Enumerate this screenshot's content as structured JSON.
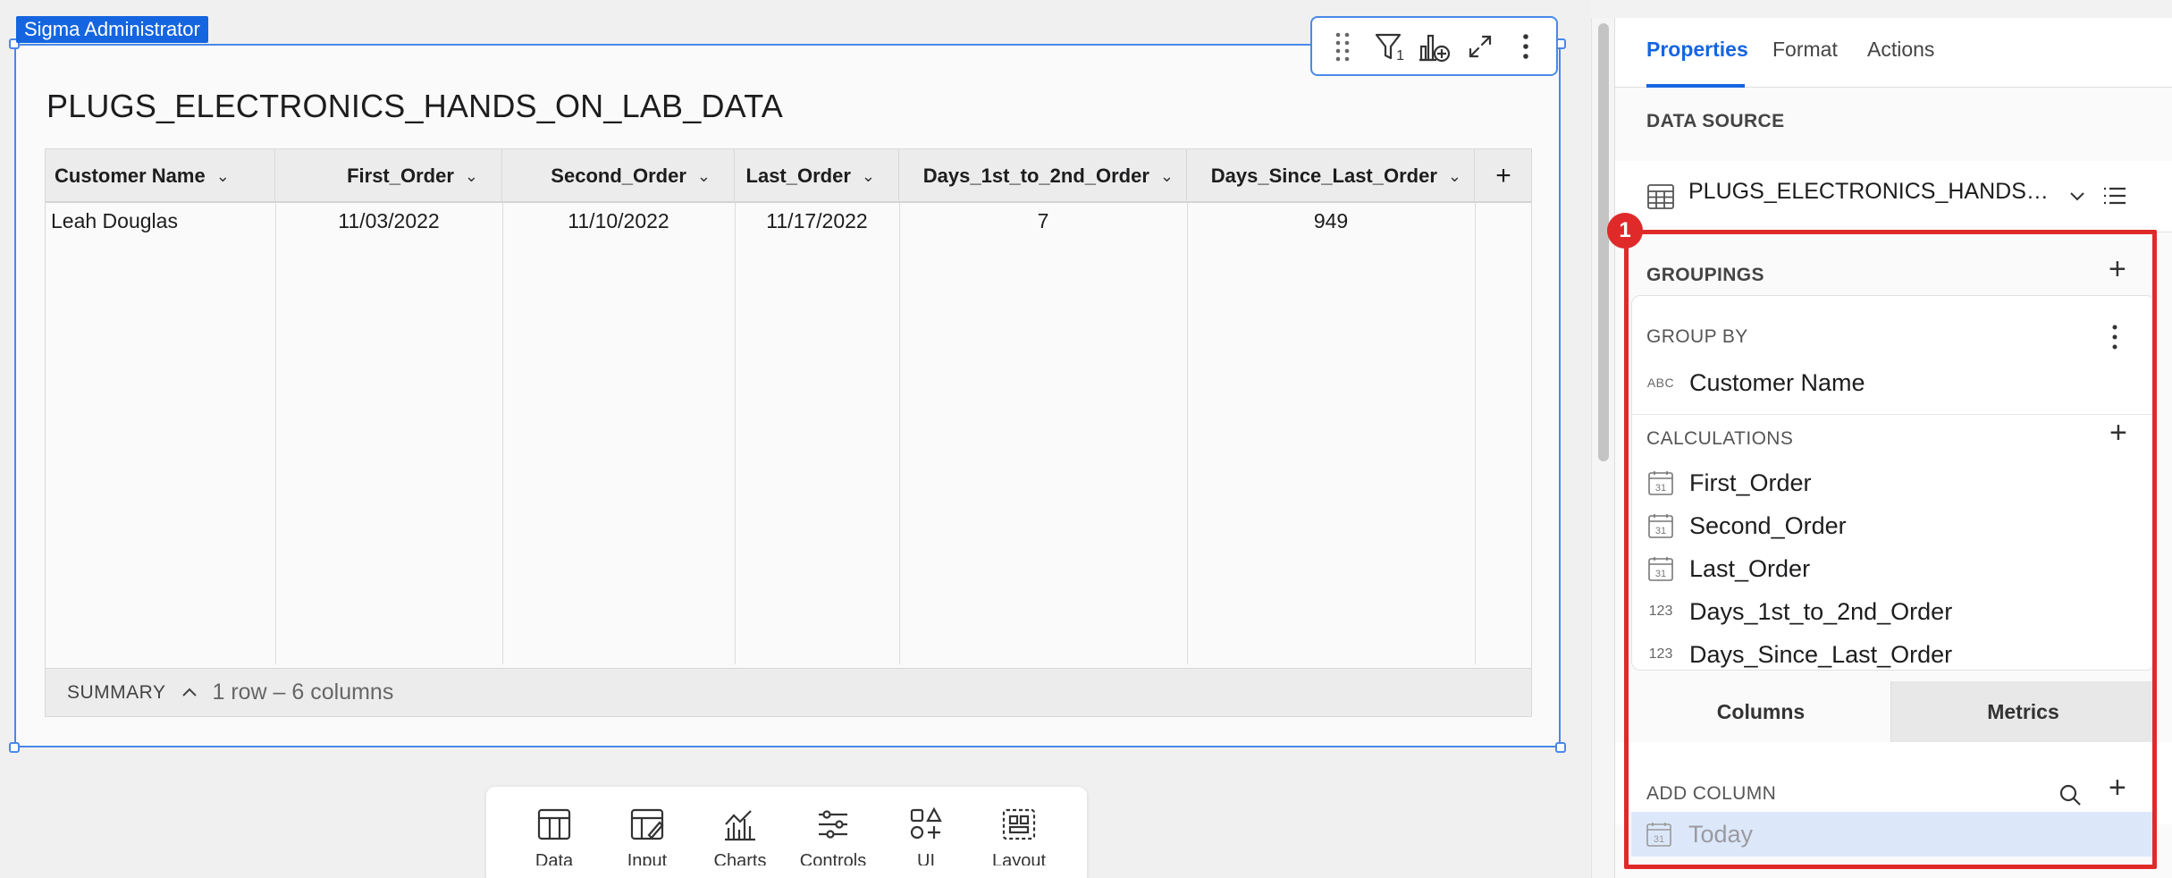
{
  "element_tag": "Sigma Administrator",
  "table": {
    "title": "PLUGS_ELECTRONICS_HANDS_ON_LAB_DATA",
    "columns": [
      "Customer Name",
      "First_Order",
      "Second_Order",
      "Last_Order",
      "Days_1st_to_2nd_Order",
      "Days_Since_Last_Order"
    ],
    "add_column_symbol": "+",
    "rows": [
      [
        "Leah Douglas",
        "11/03/2022",
        "11/10/2022",
        "11/17/2022",
        "7",
        "949"
      ]
    ],
    "summary": {
      "label": "SUMMARY",
      "chevron": "^",
      "count": "1 row – 6 columns"
    }
  },
  "toolbar": {
    "filter_count": "1",
    "icons": [
      "drag-handle-icon",
      "filter-icon",
      "add-chart-icon",
      "expand-icon",
      "more-icon"
    ]
  },
  "element_bar": {
    "items": [
      {
        "label": "Data",
        "icon": "table-icon"
      },
      {
        "label": "Input",
        "icon": "input-table-icon"
      },
      {
        "label": "Charts",
        "icon": "chart-icon"
      },
      {
        "label": "Controls",
        "icon": "controls-icon"
      },
      {
        "label": "UI",
        "icon": "ui-shapes-icon"
      },
      {
        "label": "Layout",
        "icon": "layout-icon"
      }
    ]
  },
  "panel": {
    "tabs": [
      "Properties",
      "Format",
      "Actions"
    ],
    "active_tab": "Properties",
    "data_source_label": "DATA SOURCE",
    "data_source_name": "PLUGS_ELECTRONICS_HANDS_ON_LAB_DATA",
    "groupings_label": "GROUPINGS",
    "group_by_label": "GROUP BY",
    "group_by": [
      {
        "type": "ABC",
        "name": "Customer Name"
      }
    ],
    "calculations_label": "CALCULATIONS",
    "calculations": [
      {
        "type": "31",
        "name": "First_Order"
      },
      {
        "type": "31",
        "name": "Second_Order"
      },
      {
        "type": "31",
        "name": "Last_Order"
      },
      {
        "type": "123",
        "name": "Days_1st_to_2nd_Order"
      },
      {
        "type": "123",
        "name": "Days_Since_Last_Order"
      }
    ],
    "sub_tabs": [
      "Columns",
      "Metrics"
    ],
    "active_sub_tab": "Columns",
    "add_column_label": "ADD COLUMN",
    "columns_list": [
      {
        "type": "31",
        "name": "Today"
      }
    ]
  },
  "annotation": {
    "badge": "1"
  },
  "colors": {
    "accent": "#1565e0",
    "annotation": "#e02a2a",
    "selected_row": "#dce8fa"
  }
}
